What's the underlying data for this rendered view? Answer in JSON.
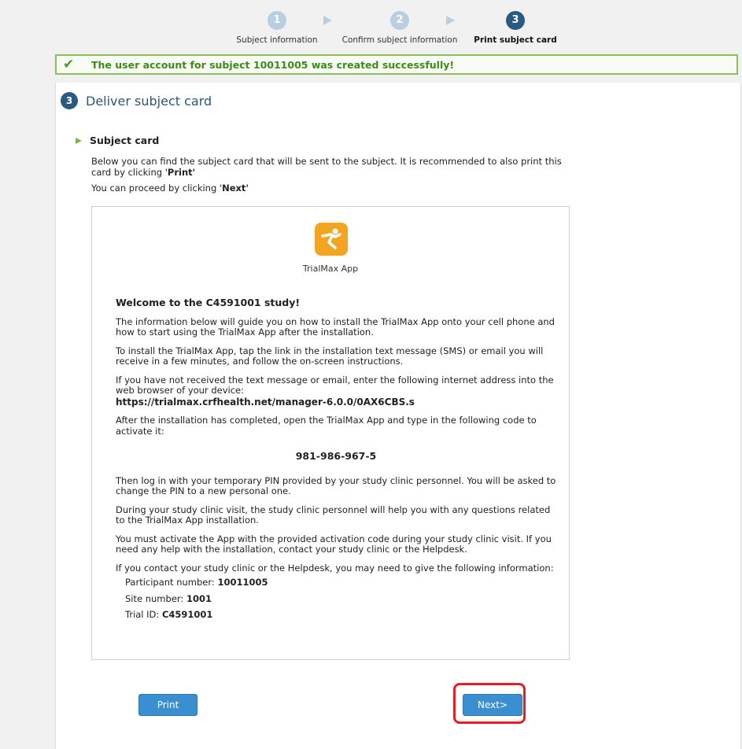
{
  "wizard": {
    "steps": [
      {
        "number": "1",
        "label": "Subject information",
        "state": "done"
      },
      {
        "number": "2",
        "label": "Confirm subject information",
        "state": "done"
      },
      {
        "number": "3",
        "label": "Print subject card",
        "state": "active"
      }
    ]
  },
  "banner": {
    "message": "The user account for subject 10011005 was created successfully!",
    "status_color": "#3f8a1e"
  },
  "section": {
    "number": "3",
    "title": "Deliver subject card"
  },
  "subject_card": {
    "heading": "Subject card",
    "intro_1_a": "Below you can find the subject card that will be sent to the subject. It is recommended to also print this card by clicking '",
    "intro_1_b": "Print",
    "intro_1_c": "'",
    "intro_2_a": "You can proceed by clicking '",
    "intro_2_b": "Next",
    "intro_2_c": "'"
  },
  "card": {
    "app_name": "TrialMax App",
    "welcome": "Welcome to the C4591001 study!",
    "p1": "The information below will guide you on how to install the TrialMax App onto your cell phone and how to start using the TrialMax App after the installation.",
    "p2": "To install the TrialMax App, tap the link in the installation text message (SMS) or email you will receive in a few minutes, and follow the on-screen instructions.",
    "p3": "If you have not received the text message or email, enter the following internet address into the web browser of your device:",
    "url": "https://trialmax.crfhealth.net/manager-6.0.0/0AX6CBS.s",
    "p4": "After the installation has completed, open the TrialMax App and type in the following code to activate it:",
    "activation_code": "981-986-967-5",
    "p5": "Then log in with your temporary PIN provided by your study clinic personnel. You will be asked to change the PIN to a new personal one.",
    "p6": "During your study clinic visit, the study clinic personnel will help you with any questions related to the TrialMax App installation.",
    "p7": "You must activate the App with the provided activation code during your study clinic visit. If you need any help with the installation, contact your study clinic or the Helpdesk.",
    "p8": "If you contact your study clinic or the Helpdesk, you may need to give the following information:",
    "participant_label": "Participant number: ",
    "participant_value": "10011005",
    "site_label": "Site number: ",
    "site_value": "1001",
    "trial_label": "Trial ID: ",
    "trial_value": "C4591001"
  },
  "buttons": {
    "print_label": "Print",
    "next_label": "Next>"
  },
  "colors": {
    "accent": "#2a5a7f",
    "button": "#3a8fd0",
    "app_logo": "#f3a521",
    "highlight": "#e21f26"
  }
}
